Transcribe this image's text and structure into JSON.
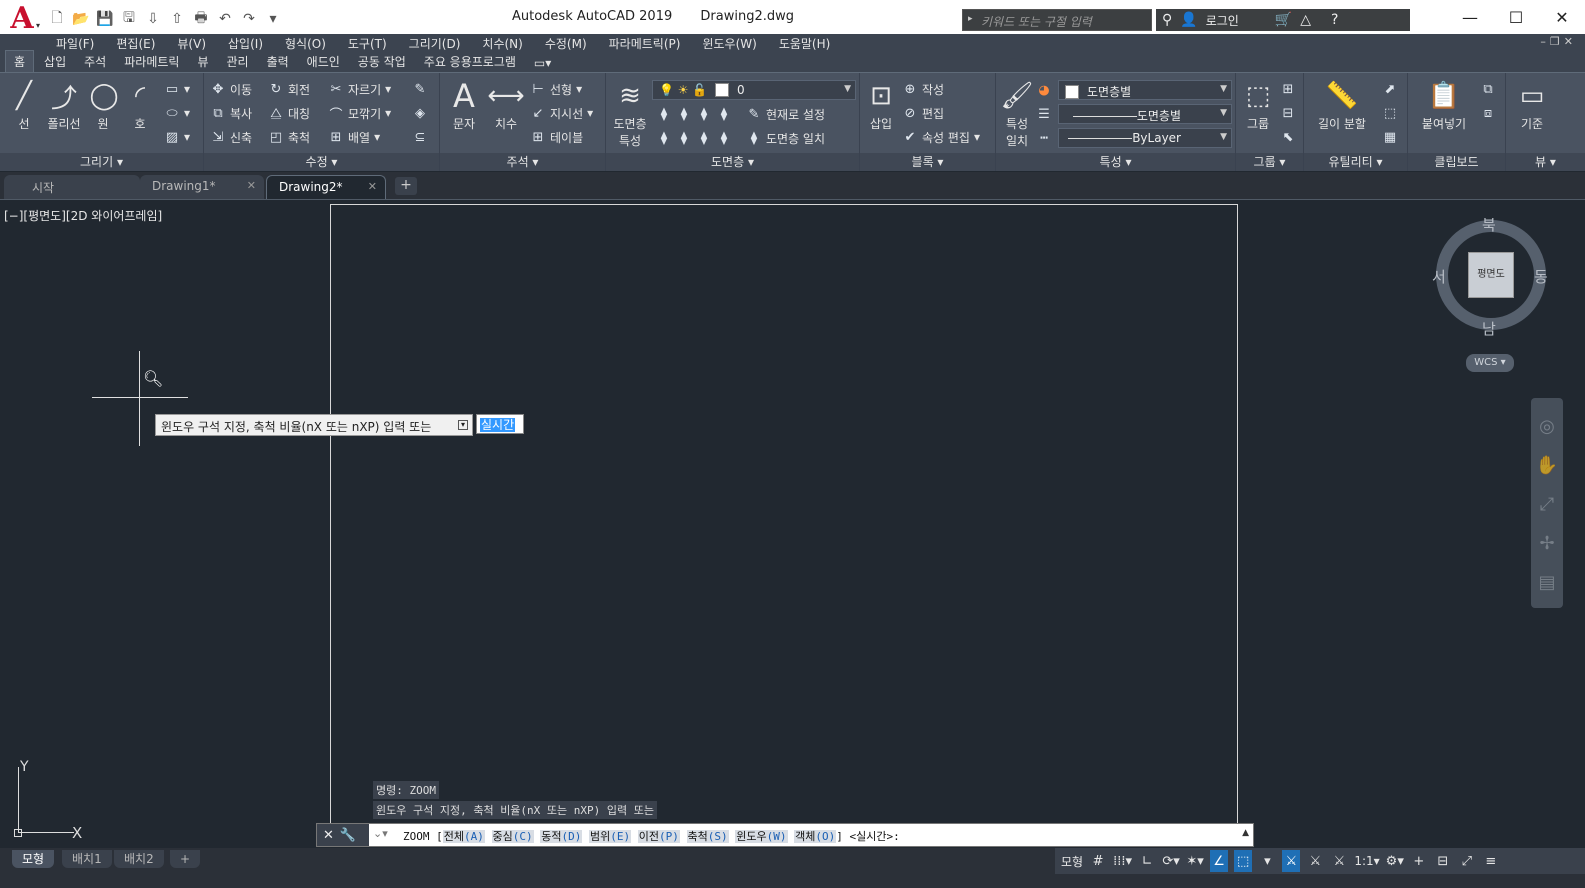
{
  "title": {
    "app": "Autodesk AutoCAD 2019",
    "file": "Drawing2.dwg"
  },
  "app_logo": "A",
  "search": {
    "placeholder": "키워드 또는 구절 입력"
  },
  "header": {
    "login": "로그인"
  },
  "menu": [
    "파일(F)",
    "편집(E)",
    "뷰(V)",
    "삽입(I)",
    "형식(O)",
    "도구(T)",
    "그리기(D)",
    "치수(N)",
    "수정(M)",
    "파라메트릭(P)",
    "윈도우(W)",
    "도움말(H)"
  ],
  "ribbon_tabs": [
    "홈",
    "삽입",
    "주석",
    "파라메트릭",
    "뷰",
    "관리",
    "출력",
    "애드인",
    "공동 작업",
    "주요 응용프로그램"
  ],
  "ribbon": {
    "draw": {
      "title": "그리기 ▾",
      "line": "선",
      "polyline": "폴리선",
      "circle": "원",
      "arc": "호"
    },
    "modify": {
      "title": "수정 ▾",
      "move": "이동",
      "rotate": "회전",
      "trim": "자르기",
      "copy": "복사",
      "mirror": "대칭",
      "fillet": "모깎기",
      "stretch": "신축",
      "scale": "축척",
      "array": "배열"
    },
    "annotation": {
      "title": "주석 ▾",
      "text": "문자",
      "dimension": "치수",
      "linear": "선형",
      "leader": "지시선",
      "table": "테이블"
    },
    "layers": {
      "title": "도면층 ▾",
      "layer_props_1": "도면층",
      "layer_props_2": "특성",
      "layer_value": "0",
      "make_current": "현재로 설정",
      "match_layer": "도면층 일치"
    },
    "block": {
      "title": "블록 ▾",
      "insert": "삽입",
      "create": "작성",
      "edit": "편집",
      "edit_attr": "속성 편집"
    },
    "properties": {
      "title": "특성",
      "match_1": "특성",
      "match_2": "일치",
      "color": "도면층별",
      "linetype": "도면층별",
      "lineweight": "ByLayer"
    },
    "groups": {
      "title": "그룹 ▾",
      "group": "그룹"
    },
    "utilities": {
      "title": "유틸리티 ▾",
      "measure": "길이 분할"
    },
    "clipboard": {
      "title": "클립보드",
      "paste": "붙여넣기"
    },
    "view": {
      "title": "뷰 ▾",
      "base": "기준"
    }
  },
  "doc_tabs": [
    {
      "label": "시작"
    },
    {
      "label": "Drawing1*"
    },
    {
      "label": "Drawing2*"
    }
  ],
  "viewport": {
    "label": "[−][평면도][2D 와이어프레임]",
    "tooltip": "윈도우 구석 지정, 축척 비율(nX 또는 nXP) 입력 또는",
    "live_value": "실시간",
    "viewcube": {
      "face": "평면도",
      "north": "북",
      "south": "남",
      "east": "동",
      "west": "서",
      "wcs": "WCS"
    },
    "ucs": {
      "x": "X",
      "y": "Y"
    }
  },
  "command_history": [
    "명령: ZOOM",
    "윈도우 구석 지정, 축척 비율(nX 또는 nXP) 입력 또는"
  ],
  "command_line": {
    "cmd": "ZOOM",
    "options": [
      {
        "label": "전체",
        "key": "(A)"
      },
      {
        "label": "중심",
        "key": "(C)"
      },
      {
        "label": "동적",
        "key": "(D)"
      },
      {
        "label": "범위",
        "key": "(E)"
      },
      {
        "label": "이전",
        "key": "(P)"
      },
      {
        "label": "축척",
        "key": "(S)"
      },
      {
        "label": "윈도우",
        "key": "(W)"
      },
      {
        "label": "객체",
        "key": "(O)"
      }
    ],
    "default": "<실시간>:"
  },
  "layout_tabs": [
    "모형",
    "배치1",
    "배치2"
  ],
  "status": {
    "model": "모형",
    "scale": "1:1"
  }
}
